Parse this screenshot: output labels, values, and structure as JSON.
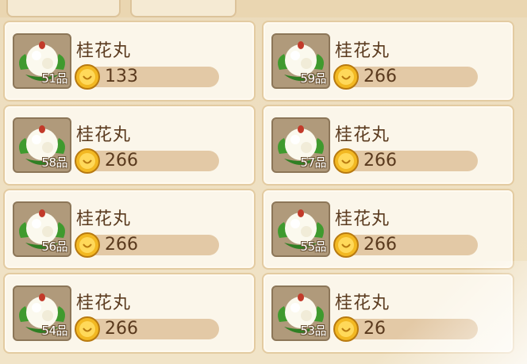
{
  "colors": {
    "card_bg": "#fbf6ea",
    "card_border": "#e3cba1",
    "text_brown": "#5a3a1e",
    "price_bar": "#e3c9a6",
    "coin_gold": "#f2b822",
    "icon_frame": "#b09a7b"
  },
  "items": [
    {
      "name": "桂花丸",
      "grade": "51品",
      "price": "133",
      "icon": "osmanthus-ball-icon",
      "currency": "gold-coin-icon"
    },
    {
      "name": "桂花丸",
      "grade": "59品",
      "price": "266",
      "icon": "osmanthus-ball-icon",
      "currency": "gold-coin-icon"
    },
    {
      "name": "桂花丸",
      "grade": "58品",
      "price": "266",
      "icon": "osmanthus-ball-icon",
      "currency": "gold-coin-icon"
    },
    {
      "name": "桂花丸",
      "grade": "57品",
      "price": "266",
      "icon": "osmanthus-ball-icon",
      "currency": "gold-coin-icon"
    },
    {
      "name": "桂花丸",
      "grade": "56品",
      "price": "266",
      "icon": "osmanthus-ball-icon",
      "currency": "gold-coin-icon"
    },
    {
      "name": "桂花丸",
      "grade": "55品",
      "price": "266",
      "icon": "osmanthus-ball-icon",
      "currency": "gold-coin-icon"
    },
    {
      "name": "桂花丸",
      "grade": "54品",
      "price": "266",
      "icon": "osmanthus-ball-icon",
      "currency": "gold-coin-icon"
    },
    {
      "name": "桂花丸",
      "grade": "53品",
      "price": "26",
      "icon": "osmanthus-ball-icon",
      "currency": "gold-coin-icon"
    }
  ]
}
